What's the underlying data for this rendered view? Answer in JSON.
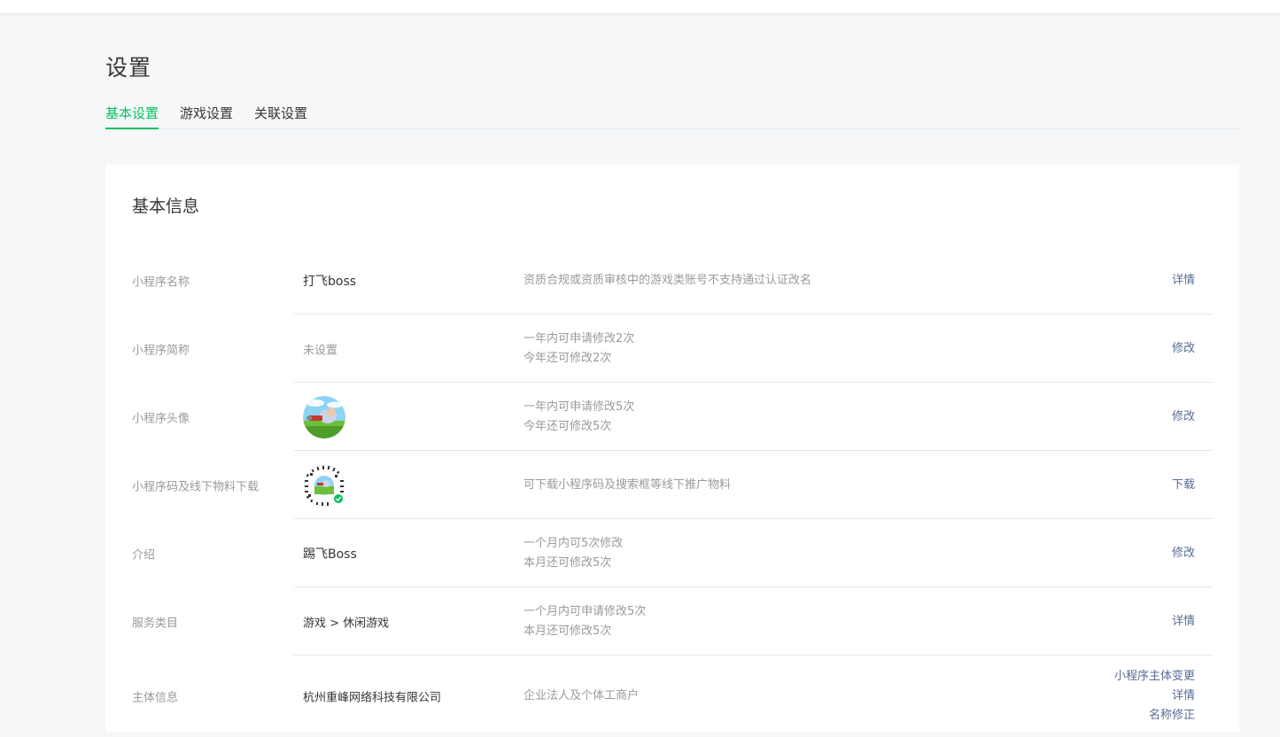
{
  "page": {
    "title": "设置"
  },
  "tabs": [
    {
      "label": "基本设置",
      "active": true
    },
    {
      "label": "游戏设置",
      "active": false
    },
    {
      "label": "关联设置",
      "active": false
    }
  ],
  "card": {
    "title": "基本信息"
  },
  "rows": [
    {
      "label": "小程序名称",
      "value": "打飞boss",
      "desc": [
        "资质合规或资质审核中的游戏类账号不支持通过认证改名"
      ],
      "actions": [
        "详情"
      ]
    },
    {
      "label": "小程序简称",
      "value": "未设置",
      "desc": [
        "一年内可申请修改2次",
        "今年还可修改2次"
      ],
      "actions": [
        "修改"
      ]
    },
    {
      "label": "小程序头像",
      "value": "",
      "desc": [
        "一年内可申请修改5次",
        "今年还可修改5次"
      ],
      "actions": [
        "修改"
      ]
    },
    {
      "label": "小程序码及线下物料下载",
      "value": "",
      "desc": [
        "可下载小程序码及搜索框等线下推广物料"
      ],
      "actions": [
        "下载"
      ]
    },
    {
      "label": "介绍",
      "value": "踢飞Boss",
      "desc": [
        "一个月内可5次修改",
        "本月还可修改5次"
      ],
      "actions": [
        "修改"
      ]
    },
    {
      "label": "服务类目",
      "value": "游戏 > 休闲游戏",
      "desc": [
        "一个月内可申请修改5次",
        "本月还可修改5次"
      ],
      "actions": [
        "详情"
      ]
    },
    {
      "label": "主体信息",
      "value": "杭州重峰网络科技有限公司",
      "desc": [
        "企业法人及个体工商户"
      ],
      "actions": [
        "小程序主体变更",
        "详情",
        "名称修正"
      ]
    }
  ],
  "colors": {
    "accent": "#07c160",
    "link": "#576b95",
    "muted": "#9a9a9a",
    "text": "#353535",
    "background": "#f6f7f9"
  }
}
